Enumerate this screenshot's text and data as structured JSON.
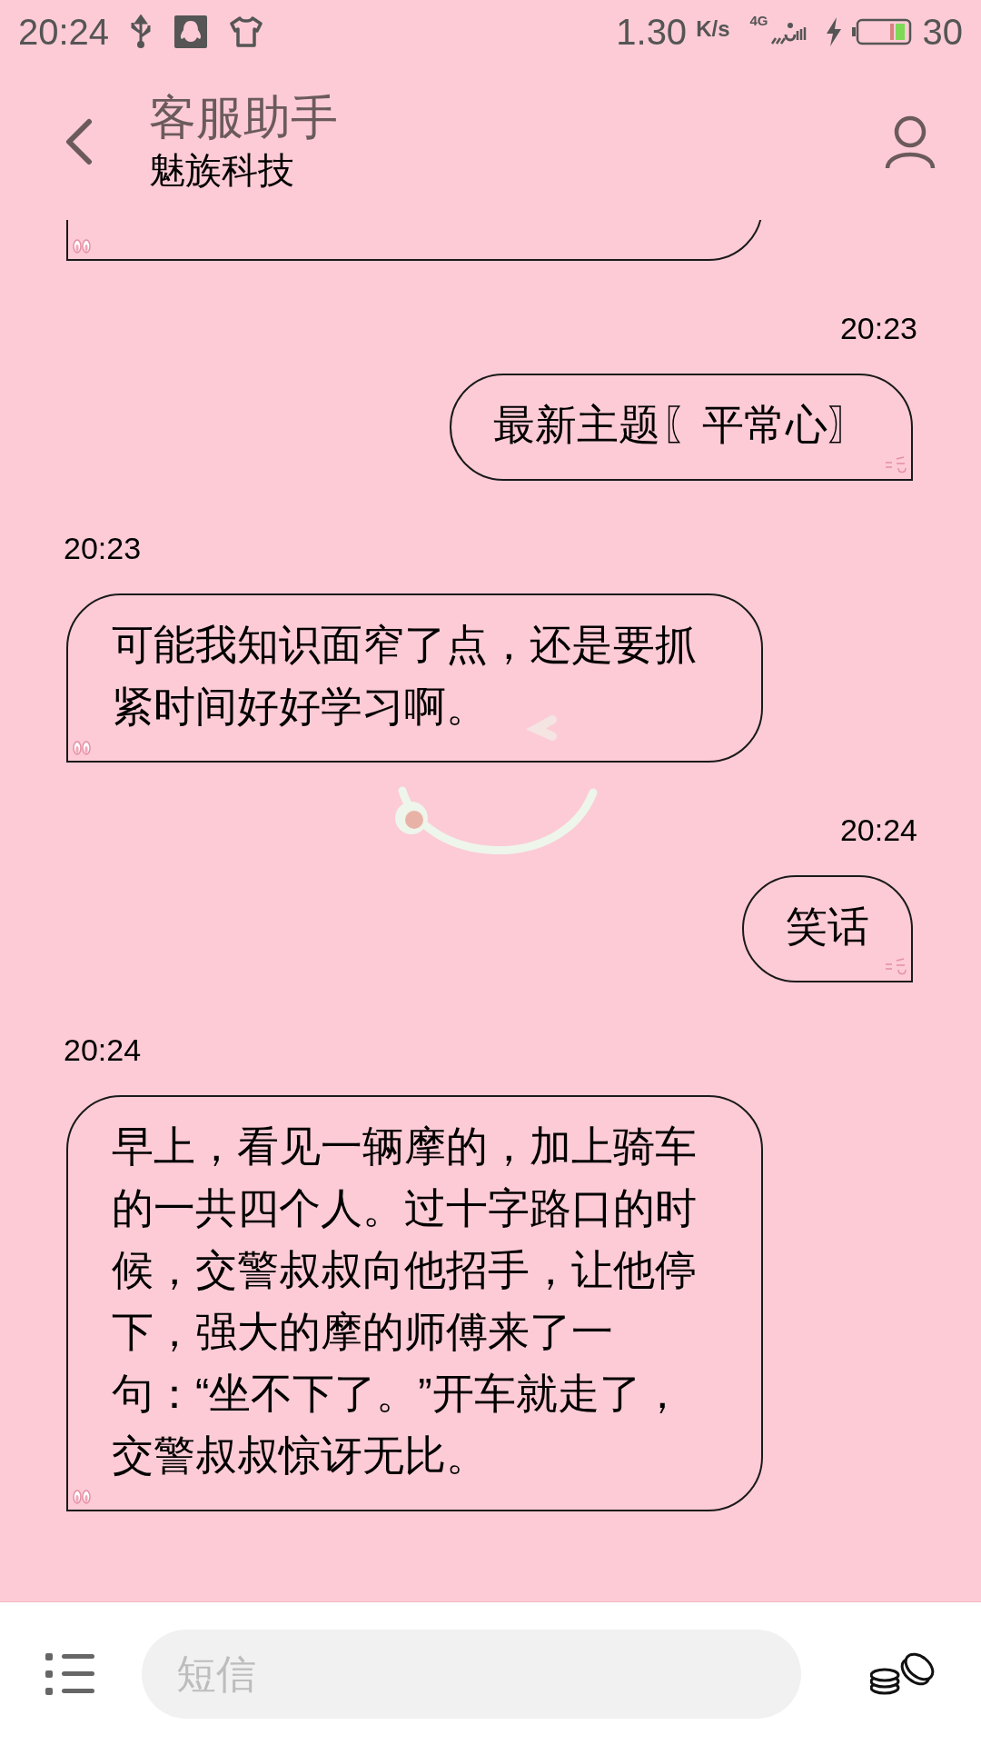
{
  "status_bar": {
    "time": "20:24",
    "speed": "1.30",
    "speed_unit": "K/s",
    "network": "4G",
    "battery": "30"
  },
  "header": {
    "title": "客服助手",
    "subtitle": "魅族科技"
  },
  "messages": [
    {
      "kind": "received"
    },
    {
      "kind": "sent",
      "time": "20:23",
      "text": "最新主题〖平常心〗"
    },
    {
      "kind": "received",
      "time": "20:23",
      "text": "可能我知识面窄了点，还是要抓紧时间好好学习啊。"
    },
    {
      "kind": "sent",
      "time": "20:24",
      "text": "笑话"
    },
    {
      "kind": "received",
      "time": "20:24",
      "text": "早上，看见一辆摩的，加上骑车的一共四个人。过十字路口的时候，交警叔叔向他招手，让他停下，强大的摩的师傅来了一句：“坐不下了。”开车就走了，交警叔叔惊讶无比。"
    }
  ],
  "compose": {
    "placeholder": "短信"
  }
}
